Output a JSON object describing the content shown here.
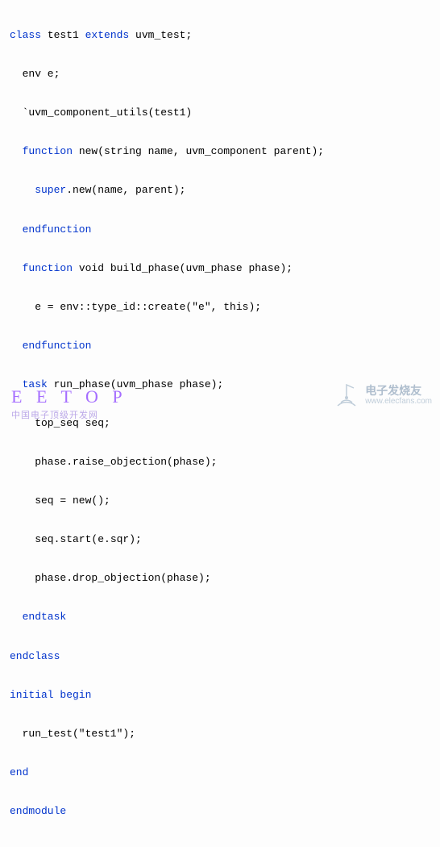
{
  "code": {
    "l1a": "class",
    "l1b": " test1 ",
    "l1c": "extends",
    "l1d": " uvm_test;",
    "l2": "env e;",
    "l3": "`uvm_component_utils(test1)",
    "l4a": "function",
    "l4b": " new(string name, uvm_component parent);",
    "l5a": "super",
    "l5b": ".new(name, parent);",
    "l6": "endfunction",
    "l7a": "function",
    "l7b": " void build_phase(uvm_phase phase);",
    "l8": "e = env::type_id::create(\"e\", this);",
    "l9": "endfunction",
    "l10a": "task",
    "l10b": " run_phase(uvm_phase phase);",
    "l11": "top_seq seq;",
    "l12": "phase.raise_objection(phase);",
    "l13": "seq = new();",
    "l14": "seq.start(e.sqr);",
    "l15": "phase.drop_objection(phase);",
    "l16": "endtask",
    "l17": "endclass",
    "l18a": "initial",
    "l18b": " begin",
    "l19": "run_test(\"test1\");",
    "l20": "end",
    "l21": "endmodule"
  },
  "watermark": {
    "eetop": "E E T O P",
    "eetop_sub": "中国电子顶级开发网",
    "right_cn": "电子发烧友",
    "right_url": "www.elecfans.com"
  }
}
